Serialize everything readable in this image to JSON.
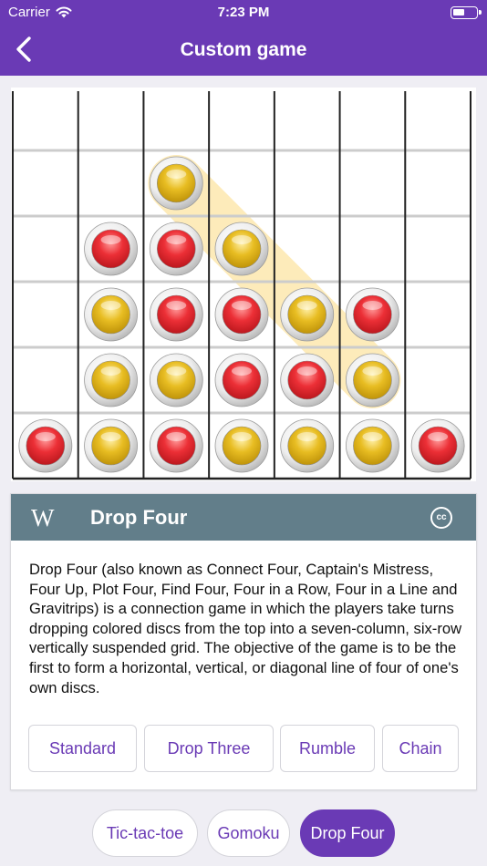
{
  "status_bar": {
    "carrier": "Carrier",
    "time": "7:23 PM"
  },
  "nav": {
    "title": "Custom game",
    "back_icon": "chevron-left-icon"
  },
  "board": {
    "columns": 7,
    "rows": 6,
    "grid_color": "#222222",
    "row_line_color": "#cccccc",
    "red_color": "#e5262d",
    "yellow_color": "#e4b81e",
    "highlight_color": "#fde9b3",
    "cells": [
      [
        "",
        "",
        "",
        "",
        "",
        "",
        ""
      ],
      [
        "",
        "",
        "Y",
        "",
        "",
        "",
        ""
      ],
      [
        "",
        "R",
        "R",
        "Y",
        "",
        "",
        ""
      ],
      [
        "",
        "Y",
        "R",
        "R",
        "Y",
        "R",
        ""
      ],
      [
        "",
        "Y",
        "Y",
        "R",
        "R",
        "Y",
        ""
      ],
      [
        "R",
        "Y",
        "R",
        "Y",
        "Y",
        "Y",
        "R"
      ]
    ],
    "winning_line": [
      [
        1,
        2
      ],
      [
        4,
        5
      ]
    ]
  },
  "info": {
    "logo": "W",
    "title": "Drop Four",
    "license_icon": "creative-commons-icon",
    "license_label": "cc",
    "description": "Drop Four (also known as Connect Four, Captain's Mistress, Four Up, Plot Four, Find Four, Four in a Row, Four in a Line and Gravitrips) is a connection game in which the players take turns dropping colored discs from the top into a seven-column, six-row vertically suspended grid. The objective of the game is to be the first to form a horizontal, vertical, or diagonal line of four of one's own discs.",
    "variants": [
      "Standard",
      "Drop Three",
      "Rumble",
      "Chain"
    ]
  },
  "games": {
    "items": [
      "Tic-tac-toe",
      "Gomoku",
      "Drop Four"
    ],
    "selected": "Drop Four"
  },
  "accent_color": "#6a3ab5",
  "header_color": "#627e8a"
}
